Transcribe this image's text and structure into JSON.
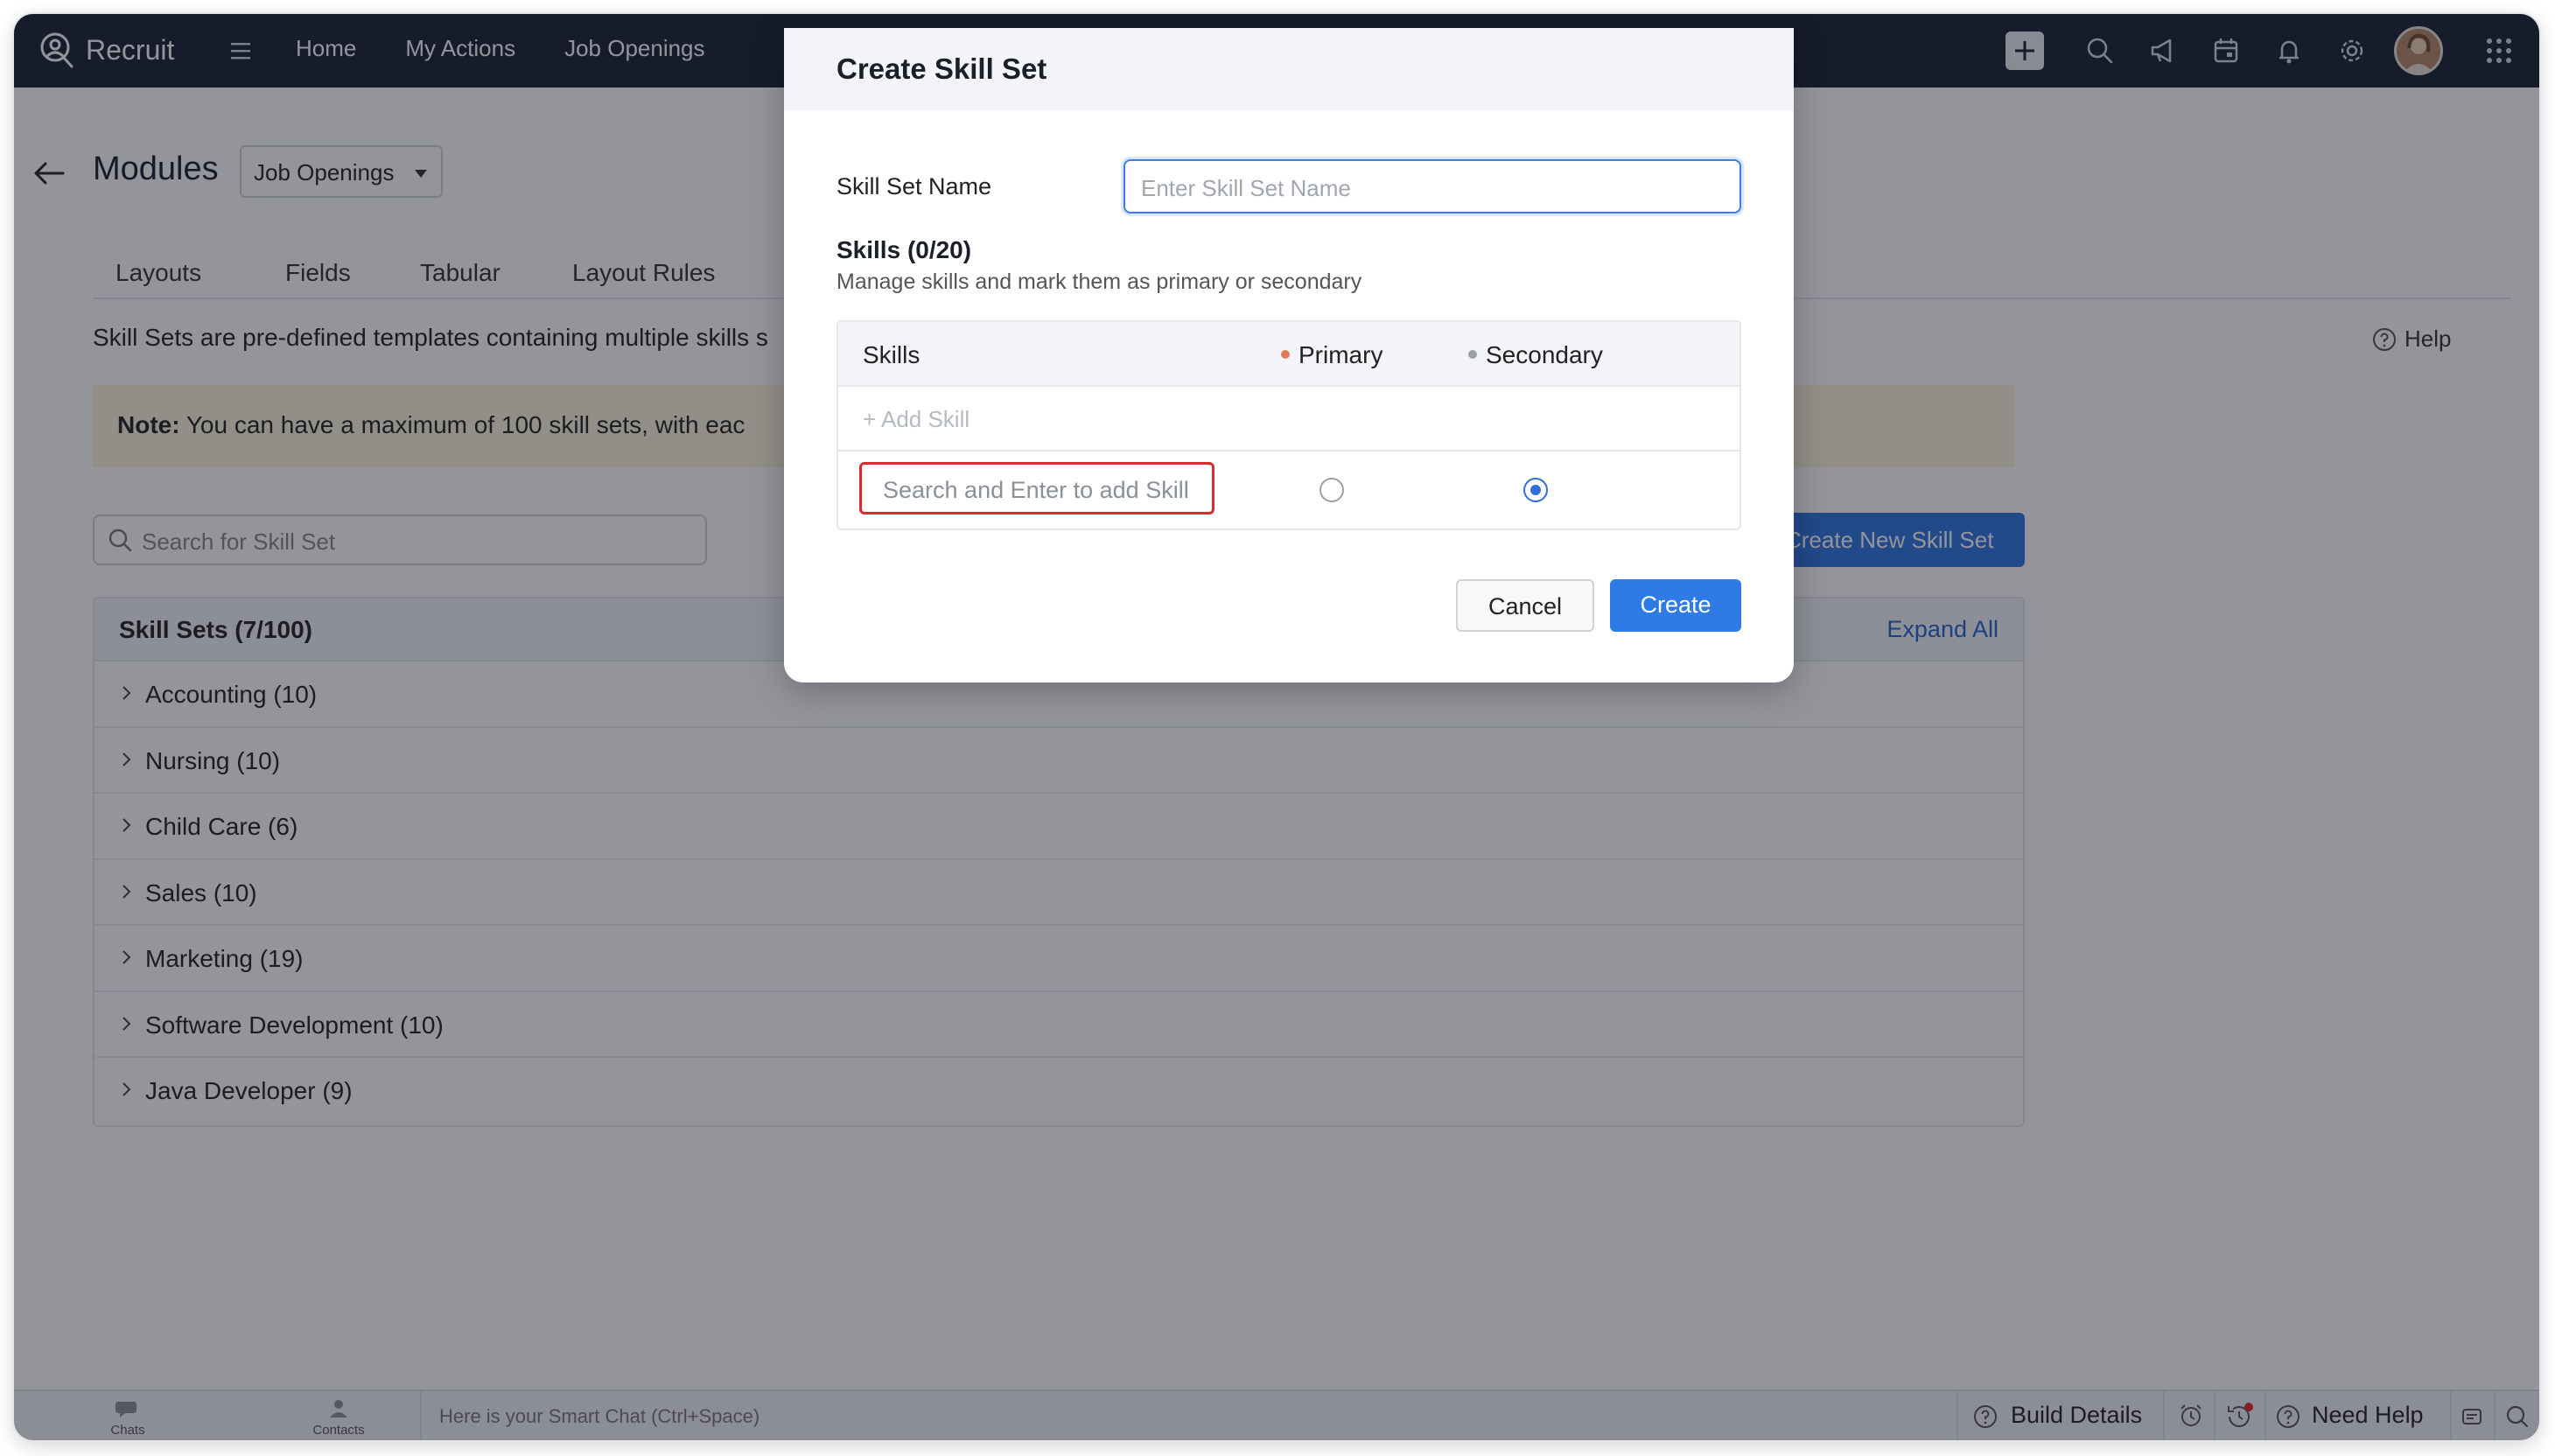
{
  "app": {
    "brand": "Recruit"
  },
  "nav": {
    "items": [
      "Home",
      "My Actions",
      "Job Openings"
    ]
  },
  "page": {
    "title": "Modules",
    "module_select": "Job Openings",
    "tabs": [
      "Layouts",
      "Fields",
      "Tabular",
      "Layout Rules"
    ],
    "description": "Skill Sets are pre-defined templates containing multiple skills s",
    "help": "Help",
    "note_label": "Note:",
    "note_text": " You can have a maximum of 100 skill sets, with eac",
    "search_placeholder": "Search for Skill Set",
    "create_new": "Create New Skill Set",
    "skillsets_title": "Skill Sets (7/100)",
    "expand_all": "Expand All",
    "skillsets": [
      "Accounting (10)",
      "Nursing (10)",
      "Child Care (6)",
      "Sales (10)",
      "Marketing (19)",
      "Software Development (10)",
      "Java Developer (9)"
    ]
  },
  "dialog": {
    "title": "Create Skill Set",
    "name_label": "Skill Set Name",
    "name_placeholder": "Enter Skill Set Name",
    "skills_count": "Skills (0/20)",
    "skills_sub": "Manage skills and mark them as primary or secondary",
    "col_skills": "Skills",
    "col_primary": "Primary",
    "col_secondary": "Secondary",
    "add_skill": "+ Add Skill",
    "skill_search_placeholder": "Search and Enter to add Skill",
    "selected_type": "Secondary",
    "cancel": "Cancel",
    "create": "Create"
  },
  "bottombar": {
    "chats": "Chats",
    "contacts": "Contacts",
    "smart_chat": "Here is your Smart Chat (Ctrl+Space)",
    "build_details": "Build Details",
    "need_help": "Need Help"
  },
  "colors": {
    "topbar": "#1b2133",
    "accent": "#2f7be6",
    "highlight": "#d92c2c",
    "note_bg": "#fbf4dc"
  }
}
